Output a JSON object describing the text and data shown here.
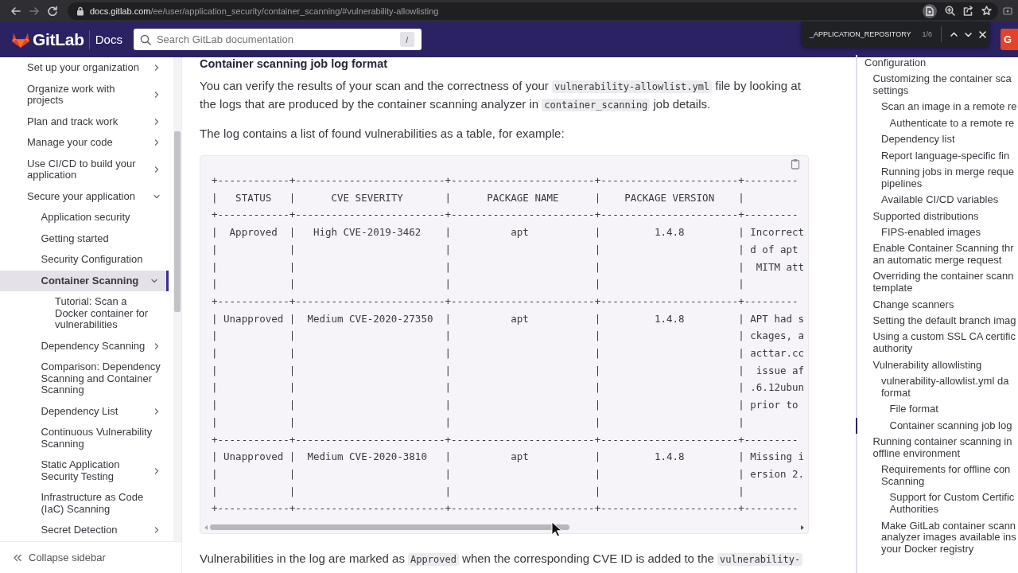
{
  "browser": {
    "url_host": "docs.gitlab.com",
    "url_path": "/ee/user/application_security/container_scanning/#vulnerability-allowlisting"
  },
  "find_bar": {
    "query": "_APPLICATION_REPOSITORY",
    "count": "1/6"
  },
  "header": {
    "logo_text": "GitLab",
    "section": "Docs",
    "search": {
      "placeholder": "Search GitLab documentation",
      "shortcut": "/"
    },
    "cut_button": "G"
  },
  "sidebar": {
    "items": [
      {
        "text": "Set up your organization",
        "expanded": false,
        "selected": false
      },
      {
        "text": "Organize work with projects",
        "expanded": false,
        "selected": false
      },
      {
        "text": "Plan and track work",
        "expanded": false,
        "selected": false
      },
      {
        "text": "Manage your code",
        "expanded": false,
        "selected": false
      },
      {
        "text": "Use CI/CD to build your application",
        "expanded": false,
        "selected": false
      },
      {
        "text": "Secure your application",
        "expanded": true,
        "selected": false,
        "children": [
          {
            "text": "Application security",
            "selected": false
          },
          {
            "text": "Getting started",
            "selected": false
          },
          {
            "text": "Security Configuration",
            "selected": false
          },
          {
            "text": "Container Scanning",
            "expanded": true,
            "selected": true,
            "children": [
              {
                "text": "Tutorial: Scan a Docker container for vulnerabilities",
                "selected": false
              }
            ]
          },
          {
            "text": "Dependency Scanning",
            "expanded": false,
            "selected": false
          },
          {
            "text": "Comparison: Dependency Scanning and Container Scanning",
            "selected": false
          },
          {
            "text": "Dependency List",
            "expanded": false,
            "selected": false
          },
          {
            "text": "Continuous Vulnerability Scanning",
            "selected": false
          },
          {
            "text": "Static Application Security Testing",
            "expanded": false,
            "selected": false
          },
          {
            "text": "Infrastructure as Code (IaC) Scanning",
            "selected": false
          },
          {
            "text": "Secret Detection",
            "expanded": false,
            "selected": false
          }
        ]
      }
    ],
    "collapse_label": "Collapse sidebar"
  },
  "article": {
    "heading": "Container scanning job log format",
    "content": [
      {
        "kind": "paragraph",
        "parts": [
          {
            "kind": "text",
            "text": "You can verify the results of your scan and the correctness of your "
          },
          {
            "kind": "code",
            "text": "vulnerability-allowlist.yml"
          },
          {
            "kind": "text",
            "text": " file by looking at the logs that are produced by the container scanning analyzer in "
          },
          {
            "kind": "code",
            "text": "container_scanning"
          },
          {
            "kind": "text",
            "text": " job details."
          }
        ]
      },
      {
        "kind": "paragraph",
        "parts": [
          {
            "kind": "text",
            "text": "The log contains a list of found vulnerabilities as a table, for example:"
          }
        ]
      },
      {
        "kind": "code_block",
        "lines": [
          "+------------+-------------------------+------------------------+-----------------------+---------",
          "|   STATUS   |      CVE SEVERITY       |      PACKAGE NAME      |    PACKAGE VERSION    |",
          "+------------+-------------------------+------------------------+-----------------------+---------",
          "|  Approved  |   High CVE-2019-3462    |          apt           |         1.4.8         | Incorrect",
          "|            |                         |                        |                       | d of apt",
          "|            |                         |                        |                       |  MITM att",
          "|            |                         |                        |                       |",
          "+------------+-------------------------+------------------------+-----------------------+---------",
          "| Unapproved |  Medium CVE-2020-27350  |          apt           |         1.4.8         | APT had s",
          "|            |                         |                        |                       | ckages, a",
          "|            |                         |                        |                       | acttar.cc",
          "|            |                         |                        |                       |  issue af",
          "|            |                         |                        |                       | .6.12ubun",
          "|            |                         |                        |                       | prior to",
          "|            |                         |                        |                       |",
          "+------------+-------------------------+------------------------+-----------------------+---------",
          "| Unapproved |  Medium CVE-2020-3810   |          apt           |         1.4.8         | Missing i",
          "|            |                         |                        |                       | ersion 2.",
          "|            |                         |                        |                       |",
          "+------------+-------------------------+------------------------+-----------------------+---------"
        ]
      },
      {
        "kind": "paragraph",
        "parts": [
          {
            "kind": "text",
            "text": "Vulnerabilities in the log are marked as "
          },
          {
            "kind": "code",
            "text": "Approved"
          },
          {
            "kind": "text",
            "text": " when the corresponding CVE ID is added to the "
          },
          {
            "kind": "code",
            "text": "vulnerability-"
          }
        ]
      }
    ]
  },
  "toc": {
    "items": [
      {
        "text": "Configuration",
        "selected": false,
        "children": [
          {
            "text": "Customizing the container sca\nsettings",
            "selected": false,
            "children": [
              {
                "text": "Scan an image in a remote re",
                "selected": false,
                "children": [
                  {
                    "text": "Authenticate to a remote re",
                    "selected": false
                  }
                ]
              },
              {
                "text": "Dependency list",
                "selected": false
              },
              {
                "text": "Report language-specific fin",
                "selected": false
              },
              {
                "text": "Running jobs in merge reque\npipelines",
                "selected": false
              },
              {
                "text": "Available CI/CD variables",
                "selected": false
              }
            ]
          },
          {
            "text": "Supported distributions",
            "selected": false,
            "children": [
              {
                "text": "FIPS-enabled images",
                "selected": false
              }
            ]
          },
          {
            "text": "Enable Container Scanning thr\nan automatic merge request",
            "selected": false
          },
          {
            "text": "Overriding the container scann\ntemplate",
            "selected": false
          },
          {
            "text": "Change scanners",
            "selected": false
          },
          {
            "text": "Setting the default branch imag",
            "selected": false
          },
          {
            "text": "Using a custom SSL CA certific\nauthority",
            "selected": false
          },
          {
            "text": "Vulnerability allowlisting",
            "selected": false,
            "children": [
              {
                "text": "vulnerability-allowlist.yml da\nformat",
                "selected": false,
                "children": [
                  {
                    "text": "File format",
                    "selected": false
                  },
                  {
                    "text": "Container scanning job log",
                    "selected": true
                  }
                ]
              }
            ]
          },
          {
            "text": "Running container scanning in\noffline environment",
            "selected": false,
            "children": [
              {
                "text": "Requirements for offline con\nScanning",
                "selected": false,
                "children": [
                  {
                    "text": "Support for Custom Certific\nAuthorities",
                    "selected": false
                  }
                ]
              },
              {
                "text": "Make GitLab container scann\nanalyzer images available ins\nyour Docker registry",
                "selected": false
              }
            ]
          }
        ]
      }
    ]
  }
}
